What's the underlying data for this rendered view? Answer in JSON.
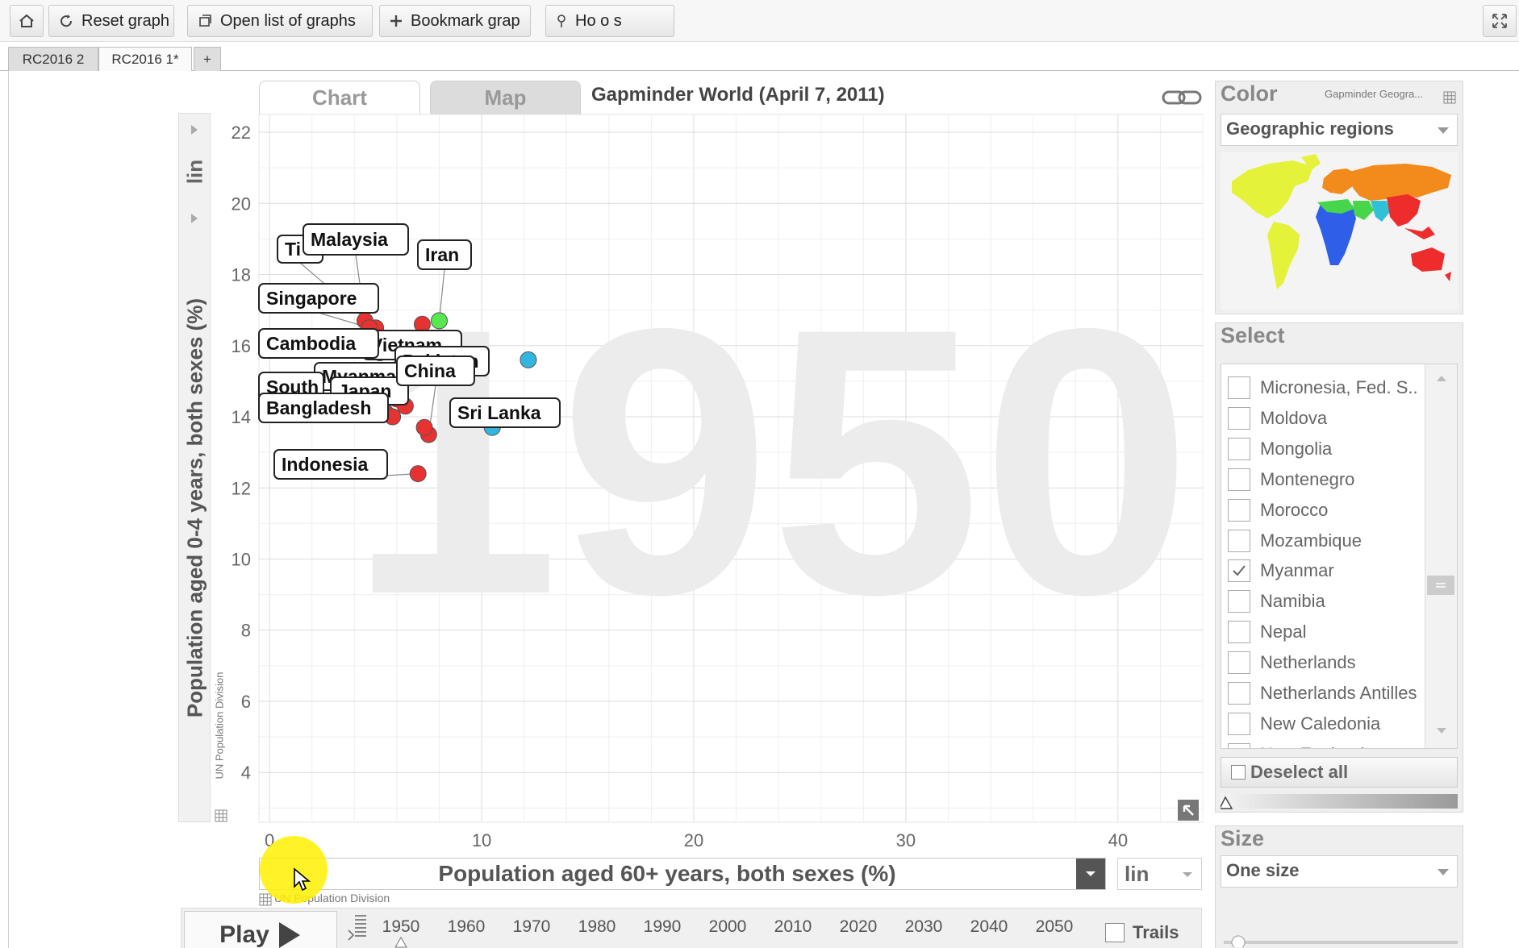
{
  "toolbar": {
    "home_icon": "home-icon",
    "reset_label": "Reset graph",
    "open_list_label": "Open list of graphs",
    "bookmark_label": "Bookmark grap",
    "howto_label": "Ho o s"
  },
  "tabs": [
    {
      "label": "RC2016 2"
    },
    {
      "label": "RC2016 1*"
    },
    {
      "label": "+"
    }
  ],
  "chart_tabs": {
    "chart": "Chart",
    "map": "Map"
  },
  "graph_title": "Gapminder World (April 7, 2011)",
  "chart_data": {
    "type": "scatter",
    "title": "",
    "xlabel": "Population aged 60+ years, both sexes (%)",
    "ylabel": "Population aged 0-4 years, both sexes (%)",
    "x_source": "UN Population Division",
    "y_source": "UN Population Division",
    "x_scale": "lin",
    "y_scale": "lin",
    "xlim": [
      -0.5,
      44
    ],
    "ylim": [
      2.6,
      22.5
    ],
    "x_ticks": [
      "0",
      "10",
      "20",
      "30",
      "40"
    ],
    "y_ticks": [
      "4",
      "6",
      "8",
      "10",
      "12",
      "14",
      "16",
      "18",
      "20",
      "22"
    ],
    "year": "1950",
    "grid": true,
    "points": [
      {
        "label": "Malaysia",
        "x": 4.5,
        "y": 16.7,
        "color": "#e83131"
      },
      {
        "label": "Ti",
        "x": 5.0,
        "y": 16.5,
        "color": "#e83131"
      },
      {
        "label": "Iran",
        "x": 8.0,
        "y": 16.7,
        "color": "#56e84e"
      },
      {
        "label": "Singapore",
        "x": 4.7,
        "y": 16.5,
        "color": "#e83131"
      },
      {
        "label": "Cambodia",
        "x": 5.2,
        "y": 15.8,
        "color": "#e83131"
      },
      {
        "label": "Vietnam",
        "x": 7.2,
        "y": 16.6,
        "color": "#e83131"
      },
      {
        "label": "Pakistan",
        "x": 7.7,
        "y": 15.4,
        "color": "#32b6e0"
      },
      {
        "label": "China",
        "x": 7.5,
        "y": 13.5,
        "color": "#e83131"
      },
      {
        "label": "Myanmar",
        "x": 6.0,
        "y": 14.5,
        "color": "#e83131"
      },
      {
        "label": "Japan",
        "x": 6.4,
        "y": 14.3,
        "color": "#e83131"
      },
      {
        "label": "South",
        "x": 5.5,
        "y": 14.1,
        "color": "#e83131"
      },
      {
        "label": "Bangladesh",
        "x": 5.8,
        "y": 14.0,
        "color": "#e83131"
      },
      {
        "label": "Sri Lanka",
        "x": 10.5,
        "y": 13.7,
        "color": "#32b6e0"
      },
      {
        "label": "Indonesia",
        "x": 7.0,
        "y": 12.4,
        "color": "#e83131"
      },
      {
        "label": "",
        "x": 7.3,
        "y": 13.7,
        "color": "#e83131"
      },
      {
        "label": "",
        "x": 12.2,
        "y": 15.6,
        "color": "#32b6e0"
      }
    ]
  },
  "color_panel": {
    "title": "Color",
    "source": "Gapminder Geogra...",
    "value": "Geographic regions"
  },
  "select_panel": {
    "title": "Select",
    "countries": [
      {
        "name": "Micronesia, Fed. S..",
        "checked": false
      },
      {
        "name": "Moldova",
        "checked": false
      },
      {
        "name": "Mongolia",
        "checked": false
      },
      {
        "name": "Montenegro",
        "checked": false
      },
      {
        "name": "Morocco",
        "checked": false
      },
      {
        "name": "Mozambique",
        "checked": false
      },
      {
        "name": "Myanmar",
        "checked": true
      },
      {
        "name": "Namibia",
        "checked": false
      },
      {
        "name": "Nepal",
        "checked": false
      },
      {
        "name": "Netherlands",
        "checked": false
      },
      {
        "name": "Netherlands Antilles",
        "checked": false
      },
      {
        "name": "New Caledonia",
        "checked": false
      },
      {
        "name": "New Zealand",
        "checked": false
      }
    ],
    "deselect_label": "Deselect all"
  },
  "size_panel": {
    "title": "Size",
    "value": "One size"
  },
  "timeline": {
    "play_label": "Play",
    "years": [
      "1950",
      "1960",
      "1970",
      "1980",
      "1990",
      "2000",
      "2010",
      "2020",
      "2030",
      "2040",
      "2050"
    ],
    "trails_label": "Trails",
    "trails_checked": false,
    "current_year": "1950"
  }
}
